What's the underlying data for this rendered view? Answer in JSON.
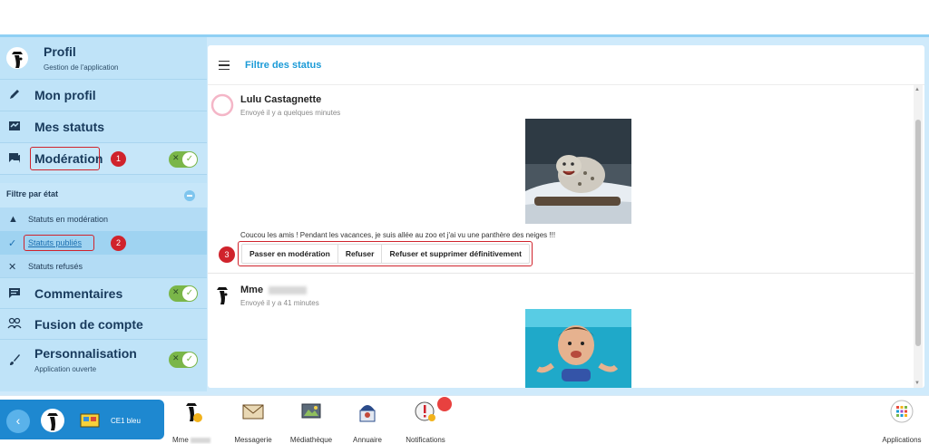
{
  "sidebar": {
    "header": {
      "title": "Profil",
      "subtitle": "Gestion de l'application"
    },
    "items": [
      {
        "label": "Mon profil",
        "icon": "pencil-icon"
      },
      {
        "label": "Mes statuts",
        "icon": "status-icon"
      },
      {
        "label": "Modération",
        "icon": "chat-icon",
        "badge": "1"
      },
      {
        "label": "Commentaires",
        "icon": "comment-icon"
      },
      {
        "label": "Fusion de compte",
        "icon": "people-icon"
      },
      {
        "label": "Personnalisation",
        "icon": "brush-icon",
        "subtitle": "Application ouverte"
      }
    ],
    "filter": {
      "title": "Filtre par état",
      "options": [
        {
          "label": "Statuts en modération",
          "icon": "warning-icon"
        },
        {
          "label": "Statuts publiés",
          "icon": "check-icon",
          "badge": "2"
        },
        {
          "label": "Statuts refusés",
          "icon": "x-icon"
        }
      ]
    }
  },
  "main": {
    "title": "Filtre des status",
    "posts": [
      {
        "author": "Lulu Castagnette",
        "time": "Envoyé il y a quelques minutes",
        "text": "Coucou les amis ! Pendant les vacances, je suis allée au zoo et j'ai vu une panthère des neiges !!!",
        "actions_badge": "3",
        "actions": [
          "Passer en modération",
          "Refuser",
          "Refuser et supprimer définitivement"
        ]
      },
      {
        "author": "Mme",
        "time": "Envoyé il y a 41 minutes"
      }
    ]
  },
  "dock": {
    "class_label": "CE1 bleu",
    "items": [
      {
        "label": "Mme"
      },
      {
        "label": "Messagerie"
      },
      {
        "label": "Médiathèque"
      },
      {
        "label": "Annuaire"
      },
      {
        "label": "Notifications"
      }
    ],
    "apps_label": "Applications"
  },
  "colors": {
    "accent": "#1c9bd7",
    "sidebar_bg": "#bfe3f8",
    "highlight": "#d0232c",
    "toggle_on": "#7ab649"
  }
}
